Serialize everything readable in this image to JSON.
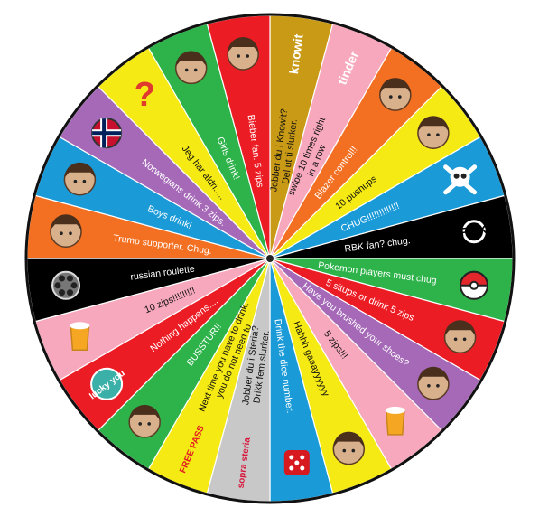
{
  "segments": [
    {
      "label": "Jobber du i Knowit? Del ut ti slurker.",
      "lines": [
        "Jobber du i Knowit?",
        "Del ut ti slurker."
      ],
      "color": "#c99a16",
      "logo": "knowit",
      "icon": "knowit-logo-icon"
    },
    {
      "label": "swipe 10 times right in a row",
      "lines": [
        "swipe 10 times right",
        "in a row"
      ],
      "color": "#f7a8bd",
      "logo": "tinder",
      "icon": "tinder-logo-icon"
    },
    {
      "label": "Blazer control!!",
      "lines": [
        "Blazer control!!"
      ],
      "color": "#f36f21",
      "icon": "blazer-man-icon"
    },
    {
      "label": "10 pushups",
      "lines": [
        "10 pushups"
      ],
      "color": "#f5ea14",
      "icon": "pushup-man-icon"
    },
    {
      "label": "CHUG!!!!!!!!!!!!!",
      "lines": [
        "CHUG!!!!!!!!!!!!!"
      ],
      "color": "#1b9ad8",
      "icon": "skull-crossbones-icon"
    },
    {
      "label": "RBK fan? chug.",
      "lines": [
        "RBK fan? chug."
      ],
      "color": "#000000",
      "logo": "RBK",
      "icon": "rbk-badge-icon"
    },
    {
      "label": "Pokemon players must chug",
      "lines": [
        "Pokemon players must chug"
      ],
      "color": "#2db34a",
      "icon": "pokeball-icon"
    },
    {
      "label": "5 situps or drink 5 zips",
      "lines": [
        "5 situps or drink 5 zips"
      ],
      "color": "#ec1c24",
      "icon": "situp-man-icon"
    },
    {
      "label": "Have you brushed your shoes?",
      "lines": [
        "Have you brushed your shoes?"
      ],
      "color": "#a569b8",
      "icon": "shoes-icon"
    },
    {
      "label": "5 zips!!!",
      "lines": [
        "5 zips!!!"
      ],
      "color": "#f7a8bd",
      "icon": "beer-glass-icon"
    },
    {
      "label": "Hahhh gaaayyyyyy",
      "lines": [
        "Hahhh gaaayyyyyy"
      ],
      "color": "#f5ea14",
      "icon": "face-photo-icon"
    },
    {
      "label": "Drink the dice number.",
      "lines": [
        "Drink the dice number."
      ],
      "color": "#1b9ad8",
      "icon": "dice-icon"
    },
    {
      "label": "Jobber du i Steria? Drikk fem slurker.",
      "lines": [
        "Jobber du i Steria?",
        "Drikk fem slurker."
      ],
      "color": "#c8c8c8",
      "logo": "sopra steria",
      "icon": "sopra-steria-logo-icon"
    },
    {
      "label": "Next time you have to drink, you do not need to",
      "lines": [
        "Next time you have to drink,",
        "you do not need to"
      ],
      "color": "#f5ea14",
      "logo": "FREE PASS",
      "icon": "free-pass-icon"
    },
    {
      "label": "BUSSTUR!!",
      "lines": [
        "BUSSTUR!!"
      ],
      "color": "#2db34a",
      "icon": "bus-icon"
    },
    {
      "label": "Nothing happens....",
      "lines": [
        "Nothing happens...."
      ],
      "color": "#ec1c24",
      "logo": "lucky you",
      "icon": "lucky-you-icon"
    },
    {
      "label": "10 zips!!!!!!!!!",
      "lines": [
        "10 zips!!!!!!!!!"
      ],
      "color": "#f7a8bd",
      "icon": "beer-glass-icon"
    },
    {
      "label": "russian roulette",
      "lines": [
        "russian roulette"
      ],
      "color": "#000000",
      "icon": "revolver-cylinder-icon"
    },
    {
      "label": "Trump supporter. Chug.",
      "lines": [
        "Trump supporter. Chug."
      ],
      "color": "#f36f21",
      "icon": "face-photo-icon"
    },
    {
      "label": "Boys drink!",
      "lines": [
        "Boys drink!"
      ],
      "color": "#1b9ad8",
      "icon": "bearded-man-icon"
    },
    {
      "label": "Norwegians drink 3 zips.",
      "lines": [
        "Norwegians drink 3 zips."
      ],
      "color": "#a569b8",
      "icon": "norway-flag-icon"
    },
    {
      "label": "Jeg har aldri.....",
      "lines": [
        "Jeg har aldri....."
      ],
      "color": "#f5ea14",
      "icon": "question-mark-icon"
    },
    {
      "label": "Girls drink!",
      "lines": [
        "Girls drink!"
      ],
      "color": "#2db34a",
      "icon": "woman-figure-icon"
    },
    {
      "label": "Bieber fan. 5 zips",
      "lines": [
        "Bieber fan. 5 zips"
      ],
      "color": "#ec1c24",
      "icon": "face-photo-icon"
    }
  ]
}
